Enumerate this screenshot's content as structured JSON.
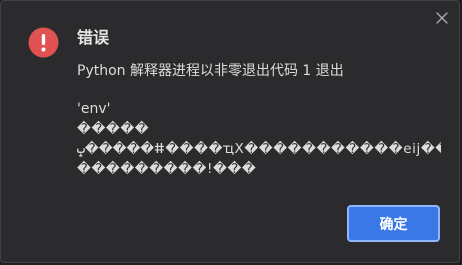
{
  "dialog": {
    "title": "错误",
    "message": "Python 解释器进程以非零退出代码 1 退出",
    "details": [
      "'env'",
      "�����",
      "ݒ�����ⵌ����ҵX�����������eij����",
      "���������!���"
    ],
    "ok_label": "确定",
    "icons": {
      "error": "error-icon",
      "close": "close-icon"
    },
    "colors": {
      "error": "#e05252",
      "primary_button": "#3b78e7"
    }
  }
}
